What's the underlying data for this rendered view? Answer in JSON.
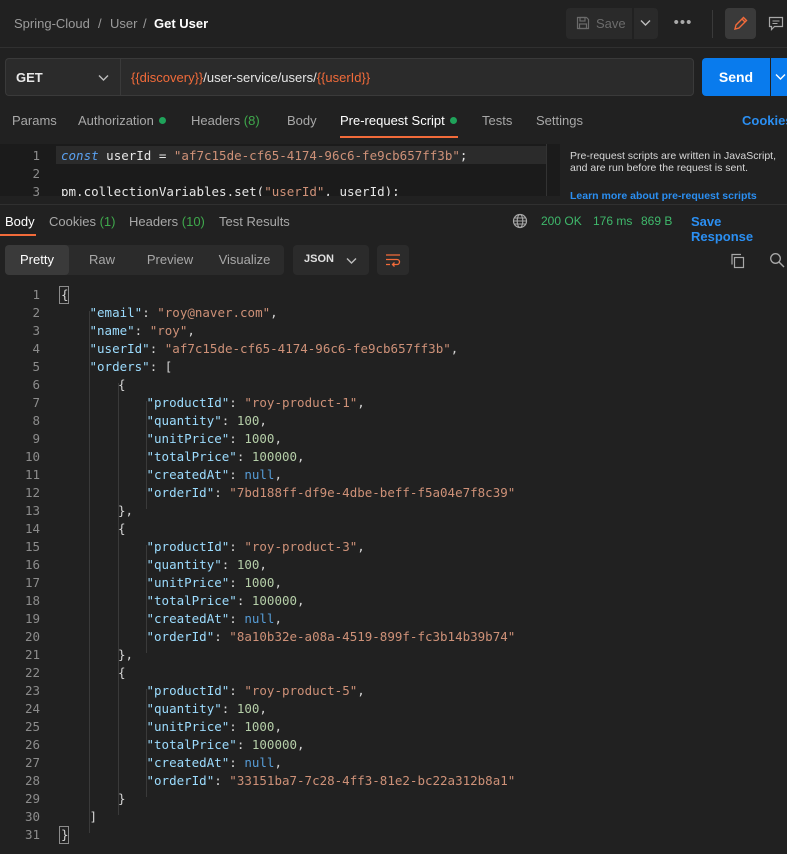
{
  "breadcrumb": {
    "workspace": "Spring-Cloud",
    "sep": "/",
    "collection": "User",
    "request": "Get User"
  },
  "header": {
    "save_label": "Save",
    "more": "•••"
  },
  "request": {
    "method": "GET",
    "url_parts": [
      {
        "text": "{{discovery}}",
        "var": true
      },
      {
        "text": "/user-service/users/",
        "var": false
      },
      {
        "text": "{{userId}}",
        "var": true
      }
    ],
    "send_label": "Send"
  },
  "request_tabs": [
    {
      "label": "Params"
    },
    {
      "label": "Authorization",
      "dot": true
    },
    {
      "label": "Headers",
      "count": "(8)"
    },
    {
      "label": "Body"
    },
    {
      "label": "Pre-request Script",
      "dot": true,
      "active": true
    },
    {
      "label": "Tests"
    },
    {
      "label": "Settings"
    }
  ],
  "cookies_label": "Cookies",
  "script": {
    "line_numbers": [
      "1",
      "2",
      "3"
    ],
    "line1": {
      "kw": "const",
      "rest": " userId = ",
      "str": "\"af7c15de-cf65-4174-96c6-fe9cb657ff3b\"",
      "end": ";"
    },
    "line3": {
      "text": "pm.collectionVariables.set(",
      "str": "\"userId\"",
      "end": ", userId);"
    }
  },
  "help": {
    "text": "Pre-request scripts are written in JavaScript, and are run before the request is sent.",
    "link": "Learn more about pre-request scripts"
  },
  "response_tabs": [
    {
      "label": "Body",
      "active": true
    },
    {
      "label": "Cookies",
      "count": "(1)"
    },
    {
      "label": "Headers",
      "count": "(10)"
    },
    {
      "label": "Test Results"
    }
  ],
  "response_status": {
    "status": "200 OK",
    "time": "176 ms",
    "size": "869 B",
    "save_label": "Save Response"
  },
  "view_modes": [
    "Pretty",
    "Raw",
    "Preview",
    "Visualize"
  ],
  "format": "JSON",
  "response_body": [
    {
      "n": "1",
      "i": 0,
      "t": [
        [
          "p",
          "{"
        ]
      ]
    },
    {
      "n": "2",
      "i": 1,
      "t": [
        [
          "k",
          "\"email\""
        ],
        [
          "p",
          ": "
        ],
        [
          "s",
          "\"roy@naver.com\""
        ],
        [
          "p",
          ","
        ]
      ]
    },
    {
      "n": "3",
      "i": 1,
      "t": [
        [
          "k",
          "\"name\""
        ],
        [
          "p",
          ": "
        ],
        [
          "s",
          "\"roy\""
        ],
        [
          "p",
          ","
        ]
      ]
    },
    {
      "n": "4",
      "i": 1,
      "t": [
        [
          "k",
          "\"userId\""
        ],
        [
          "p",
          ": "
        ],
        [
          "s",
          "\"af7c15de-cf65-4174-96c6-fe9cb657ff3b\""
        ],
        [
          "p",
          ","
        ]
      ]
    },
    {
      "n": "5",
      "i": 1,
      "t": [
        [
          "k",
          "\"orders\""
        ],
        [
          "p",
          ": ["
        ]
      ]
    },
    {
      "n": "6",
      "i": 2,
      "t": [
        [
          "p",
          "{"
        ]
      ]
    },
    {
      "n": "7",
      "i": 3,
      "t": [
        [
          "k",
          "\"productId\""
        ],
        [
          "p",
          ": "
        ],
        [
          "s",
          "\"roy-product-1\""
        ],
        [
          "p",
          ","
        ]
      ]
    },
    {
      "n": "8",
      "i": 3,
      "t": [
        [
          "k",
          "\"quantity\""
        ],
        [
          "p",
          ": "
        ],
        [
          "n",
          "100"
        ],
        [
          "p",
          ","
        ]
      ]
    },
    {
      "n": "9",
      "i": 3,
      "t": [
        [
          "k",
          "\"unitPrice\""
        ],
        [
          "p",
          ": "
        ],
        [
          "n",
          "1000"
        ],
        [
          "p",
          ","
        ]
      ]
    },
    {
      "n": "10",
      "i": 3,
      "t": [
        [
          "k",
          "\"totalPrice\""
        ],
        [
          "p",
          ": "
        ],
        [
          "n",
          "100000"
        ],
        [
          "p",
          ","
        ]
      ]
    },
    {
      "n": "11",
      "i": 3,
      "t": [
        [
          "k",
          "\"createdAt\""
        ],
        [
          "p",
          ": "
        ],
        [
          "nl",
          "null"
        ],
        [
          "p",
          ","
        ]
      ]
    },
    {
      "n": "12",
      "i": 3,
      "t": [
        [
          "k",
          "\"orderId\""
        ],
        [
          "p",
          ": "
        ],
        [
          "s",
          "\"7bd188ff-df9e-4dbe-beff-f5a04e7f8c39\""
        ]
      ]
    },
    {
      "n": "13",
      "i": 2,
      "t": [
        [
          "p",
          "},"
        ]
      ]
    },
    {
      "n": "14",
      "i": 2,
      "t": [
        [
          "p",
          "{"
        ]
      ]
    },
    {
      "n": "15",
      "i": 3,
      "t": [
        [
          "k",
          "\"productId\""
        ],
        [
          "p",
          ": "
        ],
        [
          "s",
          "\"roy-product-3\""
        ],
        [
          "p",
          ","
        ]
      ]
    },
    {
      "n": "16",
      "i": 3,
      "t": [
        [
          "k",
          "\"quantity\""
        ],
        [
          "p",
          ": "
        ],
        [
          "n",
          "100"
        ],
        [
          "p",
          ","
        ]
      ]
    },
    {
      "n": "17",
      "i": 3,
      "t": [
        [
          "k",
          "\"unitPrice\""
        ],
        [
          "p",
          ": "
        ],
        [
          "n",
          "1000"
        ],
        [
          "p",
          ","
        ]
      ]
    },
    {
      "n": "18",
      "i": 3,
      "t": [
        [
          "k",
          "\"totalPrice\""
        ],
        [
          "p",
          ": "
        ],
        [
          "n",
          "100000"
        ],
        [
          "p",
          ","
        ]
      ]
    },
    {
      "n": "19",
      "i": 3,
      "t": [
        [
          "k",
          "\"createdAt\""
        ],
        [
          "p",
          ": "
        ],
        [
          "nl",
          "null"
        ],
        [
          "p",
          ","
        ]
      ]
    },
    {
      "n": "20",
      "i": 3,
      "t": [
        [
          "k",
          "\"orderId\""
        ],
        [
          "p",
          ": "
        ],
        [
          "s",
          "\"8a10b32e-a08a-4519-899f-fc3b14b39b74\""
        ]
      ]
    },
    {
      "n": "21",
      "i": 2,
      "t": [
        [
          "p",
          "},"
        ]
      ]
    },
    {
      "n": "22",
      "i": 2,
      "t": [
        [
          "p",
          "{"
        ]
      ]
    },
    {
      "n": "23",
      "i": 3,
      "t": [
        [
          "k",
          "\"productId\""
        ],
        [
          "p",
          ": "
        ],
        [
          "s",
          "\"roy-product-5\""
        ],
        [
          "p",
          ","
        ]
      ]
    },
    {
      "n": "24",
      "i": 3,
      "t": [
        [
          "k",
          "\"quantity\""
        ],
        [
          "p",
          ": "
        ],
        [
          "n",
          "100"
        ],
        [
          "p",
          ","
        ]
      ]
    },
    {
      "n": "25",
      "i": 3,
      "t": [
        [
          "k",
          "\"unitPrice\""
        ],
        [
          "p",
          ": "
        ],
        [
          "n",
          "1000"
        ],
        [
          "p",
          ","
        ]
      ]
    },
    {
      "n": "26",
      "i": 3,
      "t": [
        [
          "k",
          "\"totalPrice\""
        ],
        [
          "p",
          ": "
        ],
        [
          "n",
          "100000"
        ],
        [
          "p",
          ","
        ]
      ]
    },
    {
      "n": "27",
      "i": 3,
      "t": [
        [
          "k",
          "\"createdAt\""
        ],
        [
          "p",
          ": "
        ],
        [
          "nl",
          "null"
        ],
        [
          "p",
          ","
        ]
      ]
    },
    {
      "n": "28",
      "i": 3,
      "t": [
        [
          "k",
          "\"orderId\""
        ],
        [
          "p",
          ": "
        ],
        [
          "s",
          "\"33151ba7-7c28-4ff3-81e2-bc22a312b8a1\""
        ]
      ]
    },
    {
      "n": "29",
      "i": 2,
      "t": [
        [
          "p",
          "}"
        ]
      ]
    },
    {
      "n": "30",
      "i": 1,
      "t": [
        [
          "p",
          "]"
        ]
      ]
    },
    {
      "n": "31",
      "i": 0,
      "t": [
        [
          "p",
          "}"
        ]
      ]
    }
  ]
}
